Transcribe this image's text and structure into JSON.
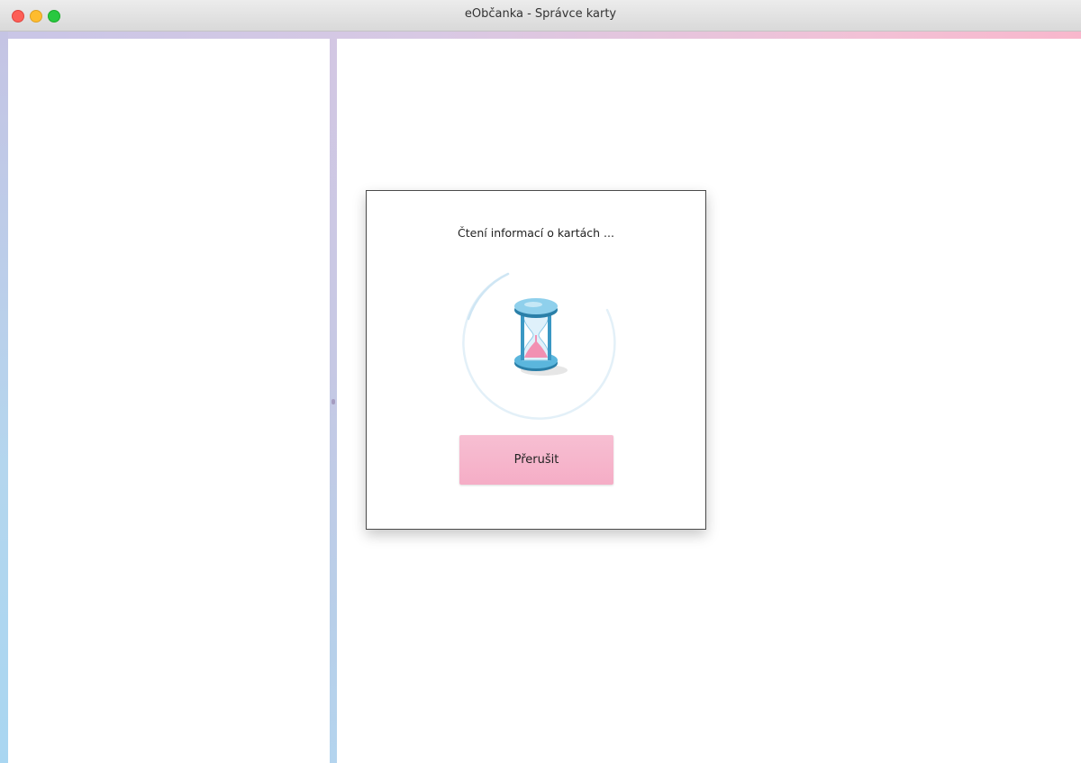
{
  "window": {
    "title": "eObčanka - Správce karty"
  },
  "dialog": {
    "message": "Čtení informací o kartách ...",
    "cancel_label": "Přerušit",
    "icon": "hourglass-icon"
  },
  "colors": {
    "accent_pink": "#f5adc6",
    "accent_blue": "#a9d6f1"
  }
}
